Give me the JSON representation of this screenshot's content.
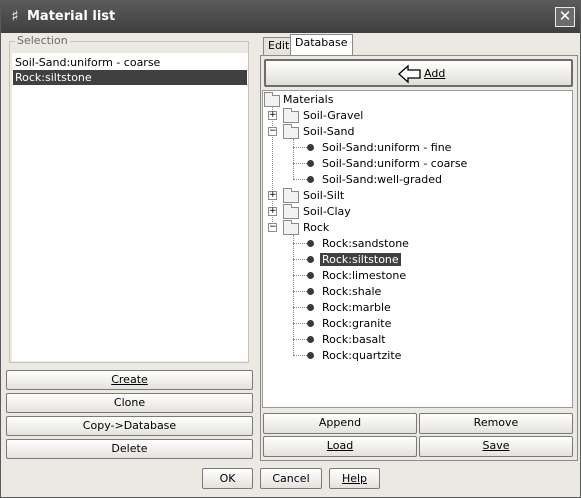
{
  "window": {
    "title": "Material list",
    "title_icon": "material-icon",
    "close_symbol": "✕"
  },
  "selection": {
    "label": "Selection",
    "items": [
      {
        "label": "Soil-Sand:uniform - coarse",
        "selected": false
      },
      {
        "label": "Rock:siltstone",
        "selected": true
      }
    ],
    "buttons": {
      "create": "Create",
      "clone": "Clone",
      "copy": "Copy->Database",
      "delete": "Delete"
    }
  },
  "tabs": [
    {
      "label": "Edit",
      "active": false
    },
    {
      "label": "Database",
      "active": true
    }
  ],
  "database": {
    "add_label": "Add",
    "add_icon": "left-arrow-icon",
    "tree": {
      "root": "Materials",
      "nodes": {
        "gravel": "Soil-Gravel",
        "sand": "Soil-Sand",
        "sand_fine": "Soil-Sand:uniform - fine",
        "sand_coarse": "Soil-Sand:uniform - coarse",
        "sand_graded": "Soil-Sand:well-graded",
        "silt": "Soil-Silt",
        "clay": "Soil-Clay",
        "rock": "Rock",
        "rock_sandstone": "Rock:sandstone",
        "rock_siltstone": "Rock:siltstone",
        "rock_limestone": "Rock:limestone",
        "rock_shale": "Rock:shale",
        "rock_marble": "Rock:marble",
        "rock_granite": "Rock:granite",
        "rock_basalt": "Rock:basalt",
        "rock_quartzite": "Rock:quartzite"
      },
      "selected": "Rock:siltstone"
    },
    "buttons": {
      "append": "Append",
      "remove": "Remove",
      "load": "Load",
      "save": "Save"
    }
  },
  "footer": {
    "ok": "OK",
    "cancel": "Cancel",
    "help": "Help"
  },
  "colors": {
    "title_bar": "#4a4a4a",
    "selection_highlight": "#404040",
    "dialog_bg": "#ece9e3"
  }
}
